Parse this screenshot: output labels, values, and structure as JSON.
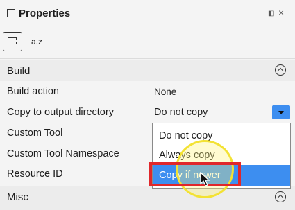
{
  "panel": {
    "title": "Properties",
    "controls": {
      "pin": "◧",
      "close": "×"
    },
    "toolbar": {
      "sort_label": "a.z"
    }
  },
  "sections": {
    "build": "Build",
    "misc": "Misc"
  },
  "rows": {
    "build_action": {
      "label": "Build action",
      "value": "None"
    },
    "copy_output": {
      "label": "Copy to output directory",
      "value": "Do not copy"
    },
    "custom_tool": {
      "label": "Custom Tool"
    },
    "custom_tool_ns": {
      "label": "Custom Tool Namespace"
    },
    "resource_id": {
      "label": "Resource ID"
    }
  },
  "dropdown": {
    "options": [
      "Do not copy",
      "Always copy",
      "Copy if newer"
    ],
    "highlighted": "Copy if newer"
  },
  "colors": {
    "accent": "#3d8ef0",
    "annotation_box": "#e0272b",
    "highlight_ring": "#f3e233"
  }
}
